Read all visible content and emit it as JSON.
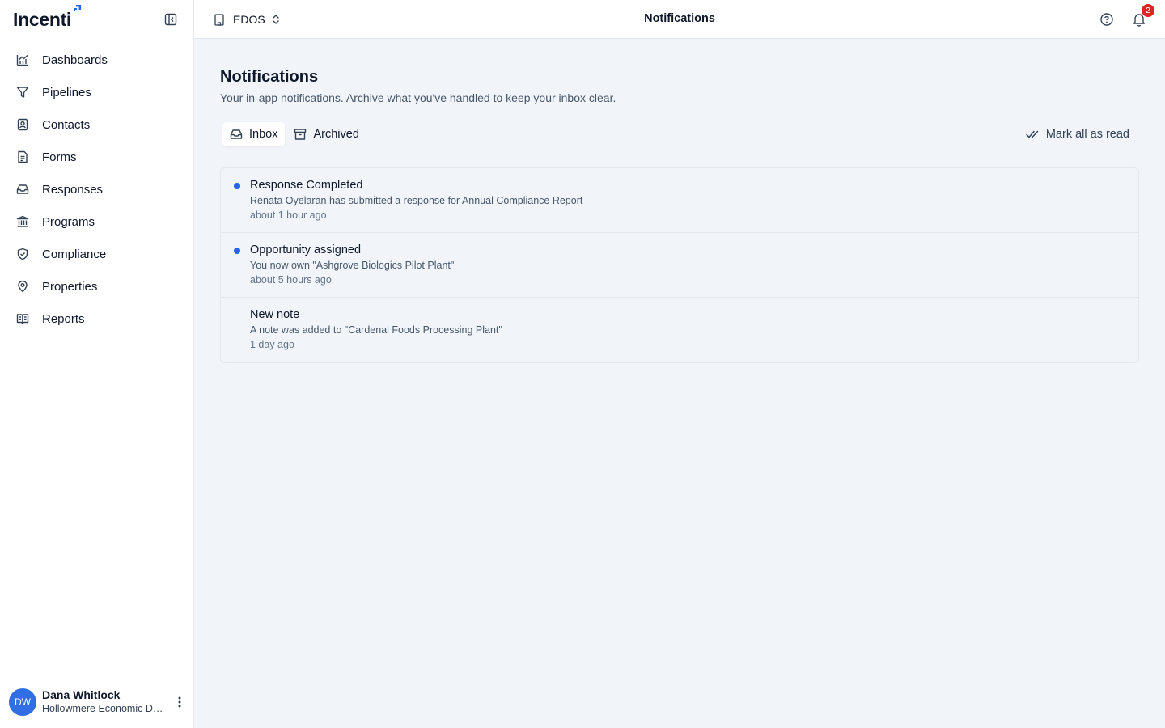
{
  "sidebar": {
    "brand": "Incenti",
    "items": [
      {
        "label": "Dashboards",
        "icon": "chart-line-icon"
      },
      {
        "label": "Pipelines",
        "icon": "funnel-icon"
      },
      {
        "label": "Contacts",
        "icon": "contact-book-icon"
      },
      {
        "label": "Forms",
        "icon": "document-icon"
      },
      {
        "label": "Responses",
        "icon": "inbox-icon"
      },
      {
        "label": "Programs",
        "icon": "landmark-icon"
      },
      {
        "label": "Compliance",
        "icon": "shield-check-icon"
      },
      {
        "label": "Properties",
        "icon": "map-pin-icon"
      },
      {
        "label": "Reports",
        "icon": "open-book-icon"
      }
    ],
    "user": {
      "initials": "DW",
      "name": "Dana Whitlock",
      "org": "Hollowmere Economic Development"
    }
  },
  "topbar": {
    "org": "EDOS",
    "title": "Notifications",
    "notification_count": "2"
  },
  "main": {
    "title": "Notifications",
    "subtitle": "Your in-app notifications. Archive what you've handled to keep your inbox clear.",
    "tabs": [
      {
        "label": "Inbox",
        "active": true
      },
      {
        "label": "Archived",
        "active": false
      }
    ],
    "mark_all_label": "Mark all as read",
    "notifications": [
      {
        "title": "Response Completed",
        "body": "Renata Oyelaran has submitted a response for Annual Compliance Report",
        "time": "about 1 hour ago",
        "unread": true
      },
      {
        "title": "Opportunity assigned",
        "body": "You now own \"Ashgrove Biologics Pilot Plant\"",
        "time": "about 5 hours ago",
        "unread": true
      },
      {
        "title": "New note",
        "body": "A note was added to \"Cardenal Foods Processing Plant\"",
        "time": "1 day ago",
        "unread": false
      }
    ]
  },
  "colors": {
    "accent": "#2563eb",
    "badge": "#dc2626",
    "avatar": "#2f6ee5",
    "page_bg": "#f1f5f9"
  }
}
